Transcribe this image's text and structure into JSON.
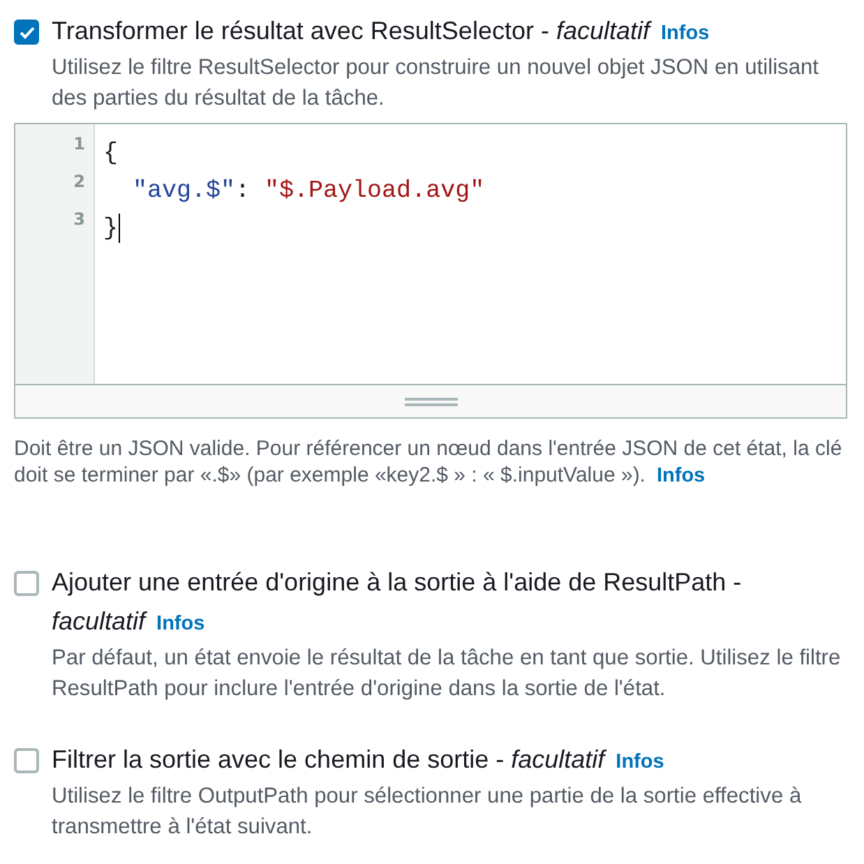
{
  "options": [
    {
      "kind": "editor",
      "checked": true,
      "label": "Transformer le résultat avec ResultSelector - *facultatif*",
      "info_link": "Infos",
      "description": "Utilisez le filtre ResultSelector pour construire un nouvel objet JSON en utilisant des parties du résultat de la tâche.",
      "editor": {
        "lines": [
          {
            "number": "1",
            "cursor": false,
            "tokens": [
              {
                "kind": "punctuation",
                "text": "{"
              }
            ]
          },
          {
            "number": "2",
            "cursor": false,
            "tokens": [
              {
                "kind": "key",
                "text": "  \"avg.$\""
              },
              {
                "kind": "punctuation",
                "text": ": "
              },
              {
                "kind": "string",
                "text": "\"$.Payload.avg\""
              }
            ]
          },
          {
            "number": "3",
            "cursor": true,
            "tokens": [
              {
                "kind": "punctuation",
                "text": "}"
              }
            ]
          }
        ]
      },
      "help": {
        "text": "Doit être un JSON valide. Pour référencer un nœud dans l'entrée JSON de cet état, la clé doit se terminer par «.$» (par exemple «key2.$ » : « $.inputValue »).",
        "info_link": "Infos"
      }
    },
    {
      "kind": "plain",
      "checked": false,
      "label": "Ajouter une entrée d'origine à la sortie à l'aide de ResultPath - *facultatif*",
      "info_link": "Infos",
      "description": "Par défaut, un état envoie le résultat de la tâche en tant que sortie. Utilisez le filtre ResultPath pour inclure l'entrée d'origine dans la sortie de l'état."
    },
    {
      "kind": "plain",
      "checked": false,
      "label": "Filtrer la sortie avec le chemin de sortie - *facultatif*",
      "info_link": "Infos",
      "description": "Utilisez le filtre OutputPath pour sélectionner une partie de la sortie effective à transmettre à l'état suivant."
    }
  ]
}
